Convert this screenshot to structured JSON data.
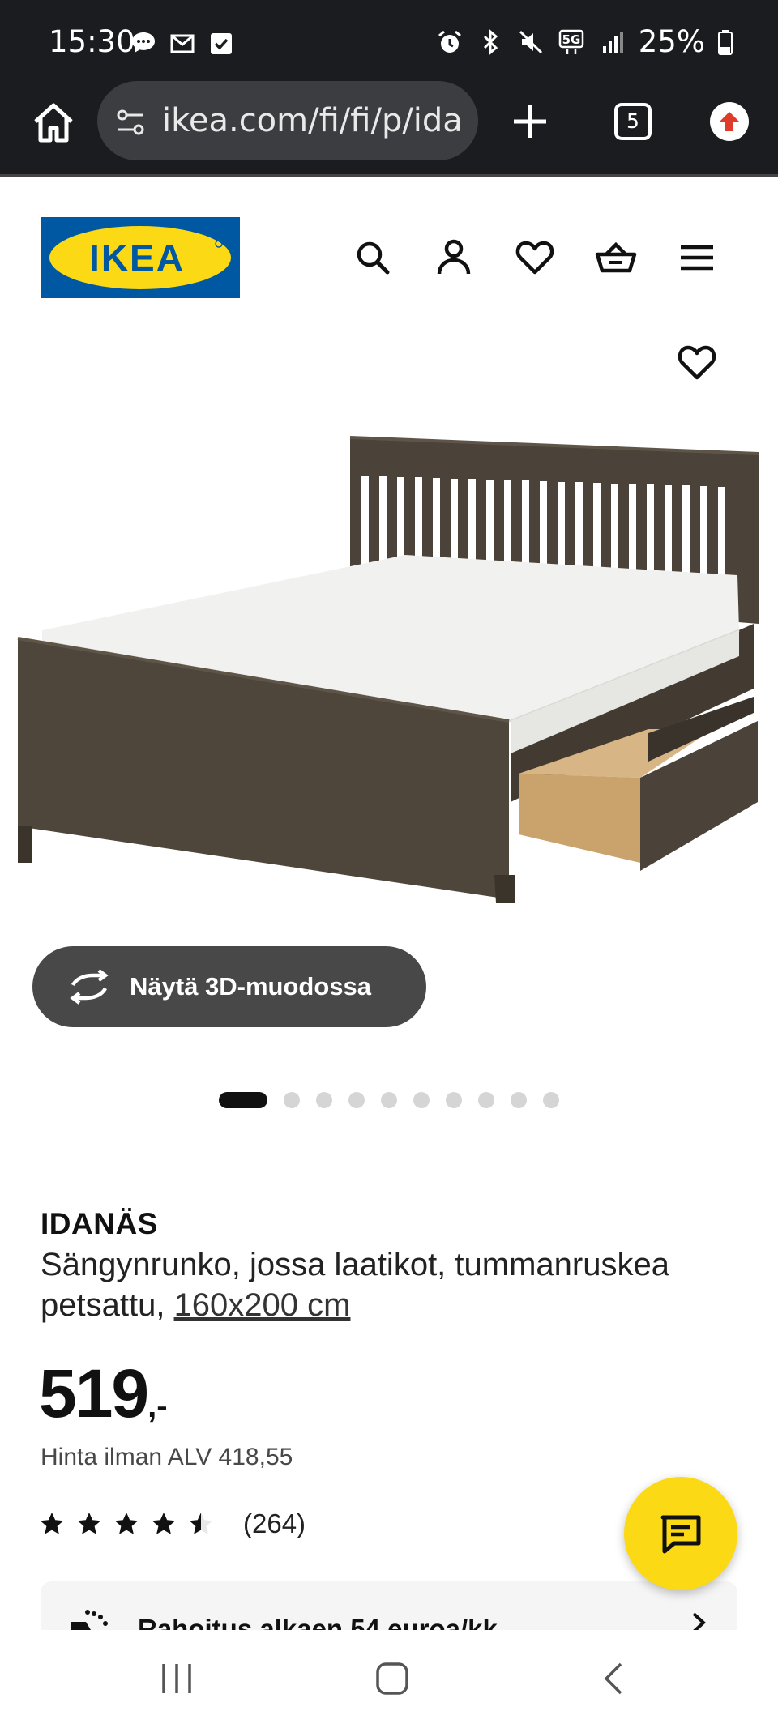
{
  "status_bar": {
    "time": "15:30",
    "battery": "25%",
    "left_icons": [
      "chat-bubble-icon",
      "gmail-icon",
      "checkbox-icon"
    ],
    "right_icons": [
      "alarm-icon",
      "bluetooth-icon",
      "mute-icon",
      "5g-icon",
      "signal-icon",
      "battery-icon"
    ]
  },
  "browser": {
    "url": "ikea.com/fi/fi/p/ida",
    "tab_count": "5"
  },
  "header": {
    "logo_text": "IKEA",
    "icons": [
      "search-icon",
      "account-icon",
      "heart-icon",
      "basket-icon",
      "menu-icon"
    ]
  },
  "gallery": {
    "view_3d_label": "Näytä 3D-muodossa",
    "slide_count": 10,
    "active_slide": 1
  },
  "product": {
    "name": "IDANÄS",
    "description": "Sängynrunko, jossa laatikot, tummanruskea petsattu,",
    "size": "160x200 cm",
    "price_main": "519",
    "price_suffix": ",-",
    "price_vat": "Hinta ilman ALV 418,55",
    "rating_value": 4.5,
    "rating_count": "(264)"
  },
  "finance": {
    "label": "Rahoitus alkaen 54 euroa/kk"
  },
  "colors": {
    "ikea_blue": "#0058a3",
    "ikea_yellow": "#fbd914",
    "browser_dark": "#1a1c1f"
  }
}
